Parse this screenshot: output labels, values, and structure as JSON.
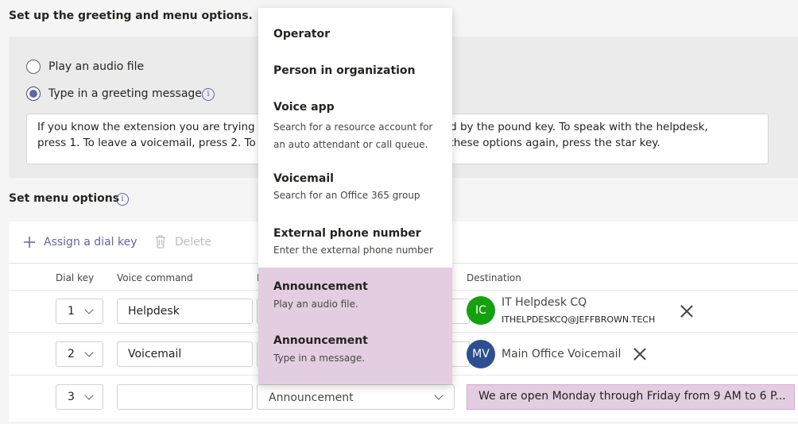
{
  "greeting": {
    "section_title": "Set up the greeting and menu options.",
    "option_audio": "Play an audio file",
    "option_type": "Type in a greeting message",
    "message_line1": "If you know the extension you are trying                                              followed by the pound key. To speak with the helpdesk,",
    "message_line2": "press 1. To leave a voicemail, press 2. To s                                              hear these options again, press the star key."
  },
  "menu": {
    "section_title": "Set menu options",
    "assign_label": "Assign a dial key",
    "delete_label": "Delete",
    "headers": {
      "dial_key": "Dial key",
      "voice_command": "Voice command",
      "redirect_stub": "R",
      "destination": "Destination"
    },
    "rows": [
      {
        "key": "1",
        "command": "Helpdesk",
        "dest_name": "IT Helpdesk CQ",
        "dest_sub": "ITHELPDESKCQ@JEFFBROWN.TECH",
        "avatar": "IC",
        "avatar_color": "#13a10e"
      },
      {
        "key": "2",
        "command": "Voicemail",
        "dest_name": "Main Office Voicemail",
        "avatar": "MV",
        "avatar_color": "#2b4f91"
      },
      {
        "key": "3",
        "command": "",
        "redirect": "Announcement",
        "announcement": "We are open Monday through Friday from 9 AM to 6 P..."
      }
    ]
  },
  "dropdown": {
    "items": [
      {
        "title": "Operator"
      },
      {
        "title": "Person in organization"
      },
      {
        "title": "Voice app",
        "sub1": "Search for a resource account for",
        "sub2": "an auto attendant or call queue."
      },
      {
        "title": "Voicemail",
        "sub1": "Search for an Office 365 group"
      },
      {
        "title": "External phone number",
        "sub1": "Enter the external phone number"
      },
      {
        "title": "Announcement",
        "sub1": "Play an audio file."
      },
      {
        "title": "Announcement",
        "sub1": "Type in a message."
      }
    ]
  },
  "colors": {
    "accent": "#6264a7",
    "highlight": "#e3cde1"
  }
}
